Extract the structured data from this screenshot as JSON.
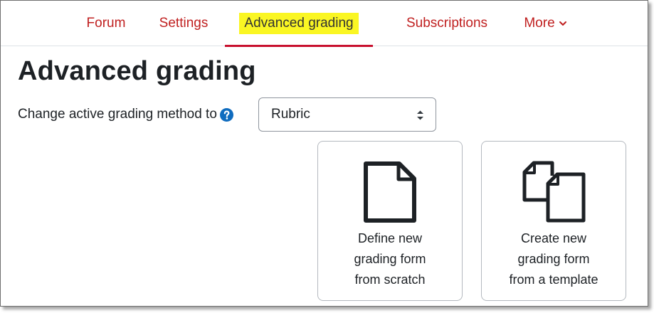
{
  "nav": {
    "items": [
      {
        "label": "Forum"
      },
      {
        "label": "Settings"
      },
      {
        "label": "Advanced grading",
        "active": true
      },
      {
        "label": "Subscriptions"
      },
      {
        "label": "More"
      }
    ],
    "more_icon": "chevron-down-icon",
    "accent_color": "#c02020",
    "highlight_color": "#faf623"
  },
  "page": {
    "title": "Advanced grading"
  },
  "method": {
    "label": "Change active grading method to",
    "help_icon": "question-circle-icon",
    "selected": "Rubric"
  },
  "cards": [
    {
      "icon": "file-icon",
      "lines": [
        "Define new",
        "grading form",
        "from scratch"
      ]
    },
    {
      "icon": "copy-files-icon",
      "lines": [
        "Create new",
        "grading form",
        "from a template"
      ]
    }
  ]
}
